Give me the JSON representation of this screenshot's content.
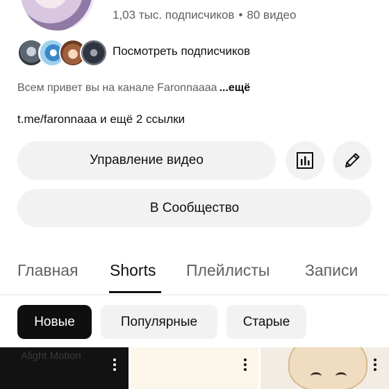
{
  "channel": {
    "subscribers": "1,03 тыс. подписчиков",
    "separator": "•",
    "videos": "80 видео"
  },
  "subscribers_row": {
    "label": "Посмотреть подписчиков"
  },
  "description": {
    "text": "Всем привет вы на канале Faronnaaaa",
    "more": "...ещё"
  },
  "links": {
    "url": "t.me/faronnaaa",
    "more": "и ещё 2 ссылки"
  },
  "buttons": {
    "manage_videos": "Управление видео",
    "community": "В Сообщество"
  },
  "tabs": [
    {
      "label": "Главная",
      "active": false
    },
    {
      "label": "Shorts",
      "active": true
    },
    {
      "label": "Плейлисты",
      "active": false
    },
    {
      "label": "Записи",
      "active": false
    }
  ],
  "chips": [
    {
      "label": "Новые",
      "active": true
    },
    {
      "label": "Популярные",
      "active": false
    },
    {
      "label": "Старые",
      "active": false
    }
  ],
  "thumbnails": [
    {
      "watermark": "Alight Motion"
    }
  ],
  "colors": {
    "text_primary": "#0f0f0f",
    "text_secondary": "#606060",
    "button_bg": "#f2f2f2",
    "chip_active_bg": "#0f0f0f"
  }
}
